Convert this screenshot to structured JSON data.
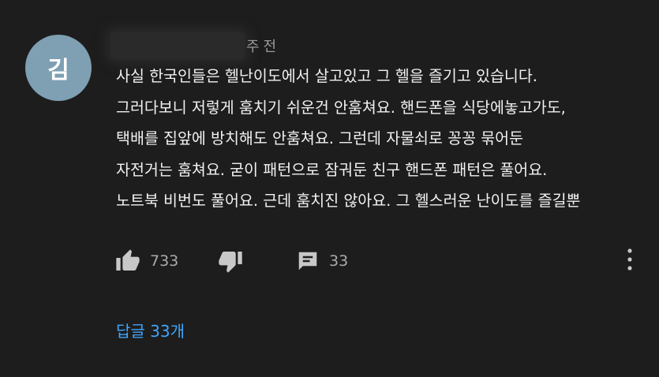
{
  "comment": {
    "avatar_initial": "김",
    "author_name": "",
    "author_suffix": "주전",
    "lines": [
      "사실 한국인들은 헬난이도에서 살고있고 그 헬을 즐기고 있습니다.",
      "그러다보니 저렇게 훔치기 쉬운건 안훔쳐요. 핸드폰을 식당에놓고가도,",
      "택배를 집앞에 방치해도 안훔쳐요. 그런데 자물쇠로 꽁꽁 묶어둔",
      "자전거는 훔쳐요. 굳이 패턴으로 잠궈둔 친구 핸드폰 패턴은 풀어요.",
      "노트북 비번도 풀어요. 근데 훔치진 않아요. 그 헬스러운 난이도를 즐길뿐"
    ],
    "like_count": "733",
    "reply_count": "33",
    "replies_link": "답글 33개"
  },
  "icons": {
    "like": "thumbs-up-icon",
    "dislike": "thumbs-down-icon",
    "reply": "comment-icon",
    "more": "more-vertical-icon"
  },
  "colors": {
    "background": "#1d1d1d",
    "text": "#f1f1f1",
    "muted": "#aaaaaa",
    "link": "#3ea6ff",
    "avatar": "#7f9fb3"
  }
}
